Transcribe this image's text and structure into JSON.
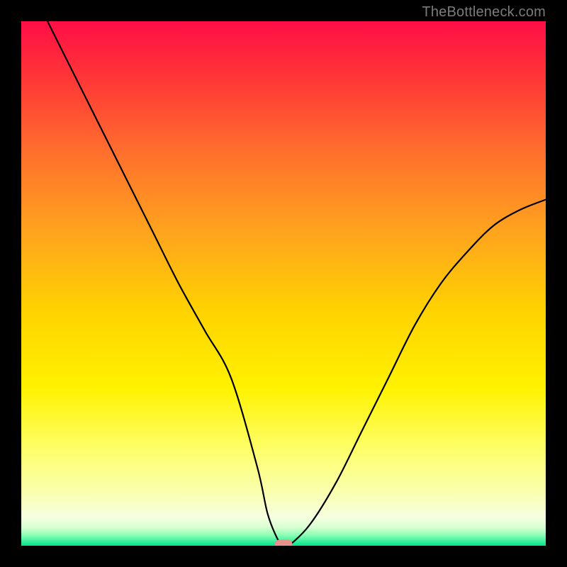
{
  "attribution": "TheBottleneck.com",
  "chart_data": {
    "type": "line",
    "title": "",
    "xlabel": "",
    "ylabel": "",
    "xlim": [
      0,
      100
    ],
    "ylim": [
      0,
      100
    ],
    "grid": false,
    "legend": false,
    "x": [
      5,
      10,
      15,
      20,
      25,
      30,
      35,
      40,
      45,
      47,
      49,
      50,
      51,
      55,
      60,
      65,
      70,
      75,
      80,
      85,
      90,
      95,
      100
    ],
    "values": [
      100,
      90,
      80,
      70,
      60,
      50,
      41,
      32,
      15,
      6,
      1,
      0,
      0,
      4,
      12,
      22,
      32,
      42,
      50,
      56,
      61,
      64,
      66
    ],
    "marker": {
      "x": 50,
      "y": 0
    }
  },
  "colors": {
    "gradient_stops": [
      {
        "offset": 0.0,
        "color": "#ff0e46"
      },
      {
        "offset": 0.1,
        "color": "#ff3338"
      },
      {
        "offset": 0.25,
        "color": "#ff6f2d"
      },
      {
        "offset": 0.4,
        "color": "#ffa31e"
      },
      {
        "offset": 0.55,
        "color": "#ffd200"
      },
      {
        "offset": 0.7,
        "color": "#fff200"
      },
      {
        "offset": 0.82,
        "color": "#fdff6d"
      },
      {
        "offset": 0.9,
        "color": "#f9ffb0"
      },
      {
        "offset": 0.945,
        "color": "#f5ffe0"
      },
      {
        "offset": 0.965,
        "color": "#d8ffd1"
      },
      {
        "offset": 0.98,
        "color": "#8affb4"
      },
      {
        "offset": 1.0,
        "color": "#00e58a"
      }
    ],
    "curve": "#000000",
    "marker_fill": "#e9908b",
    "marker_stroke": "#e9908b"
  }
}
